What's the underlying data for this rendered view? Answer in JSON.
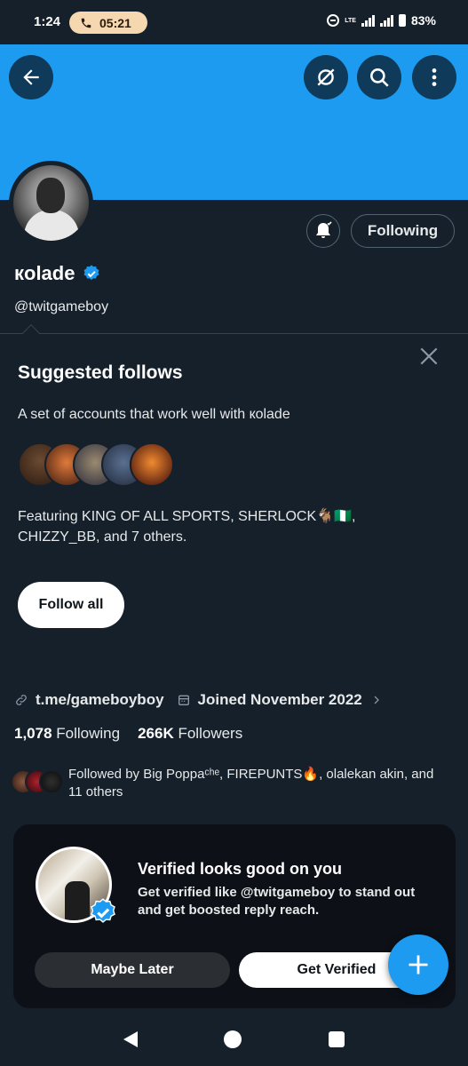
{
  "status_bar": {
    "time": "1:24",
    "call_timer": "05:21",
    "network": "LTE",
    "battery": "83%"
  },
  "profile": {
    "display_name": "кolade",
    "handle": "@twitgameboy",
    "following_button": "Following",
    "link": "t.me/gameboyboy",
    "joined": "Joined November 2022",
    "following_count": "1,078",
    "following_label": "Following",
    "followers_count": "266K",
    "followers_label": "Followers",
    "followed_by": "Followed by Big Poppaᶜʰᵉ, FIREPUNTS🔥, olalekan akin, and 11 others"
  },
  "suggested": {
    "title": "Suggested follows",
    "subtitle": "A set of accounts that work well with кolade",
    "featuring": "Featuring KING OF ALL SPORTS, SHERLOCK🐐🇳🇬, CHIZZY_BB, and 7 others.",
    "follow_all": "Follow all"
  },
  "verify_card": {
    "title": "Verified looks good on you",
    "body_prefix": "Get verified like ",
    "body_handle": "@twitgameboy",
    "body_suffix": " to stand out and get boosted reply reach.",
    "maybe_later": "Maybe Later",
    "get_verified": "Get Verified"
  },
  "colors": {
    "background": "#15202b",
    "banner": "#1d9bf0",
    "accent": "#1d9bf0"
  },
  "icons": [
    "back-arrow-icon",
    "unmute-icon",
    "search-icon",
    "more-icon",
    "bell-icon",
    "close-icon",
    "link-icon",
    "calendar-icon",
    "chevron-right-icon",
    "verified-badge-icon",
    "plus-icon"
  ]
}
